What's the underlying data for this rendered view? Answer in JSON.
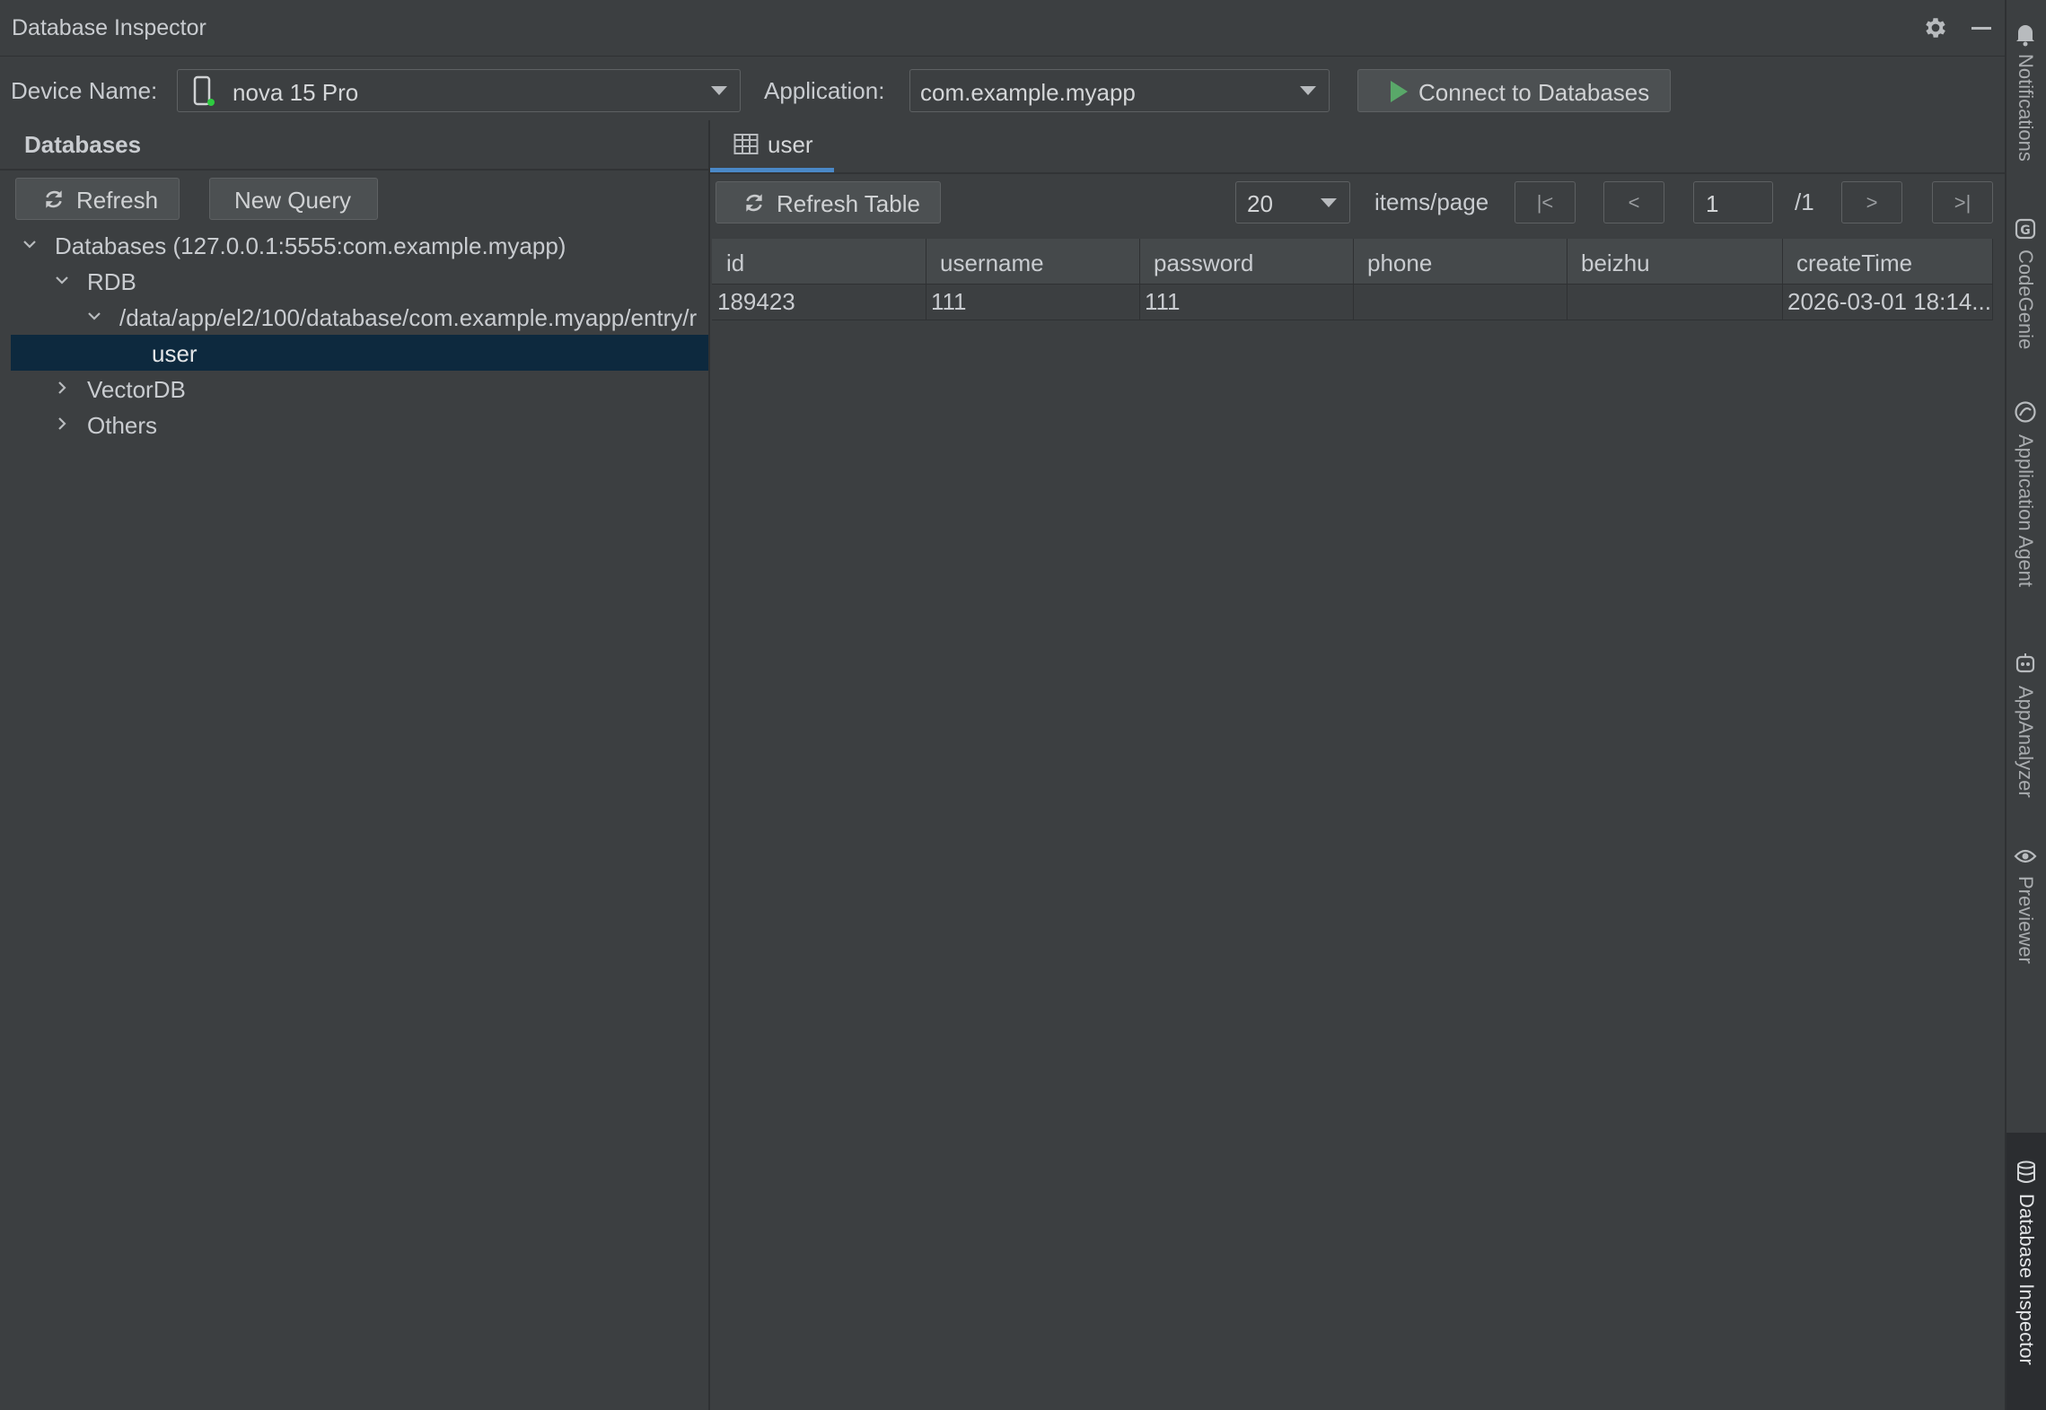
{
  "panel": {
    "title": "Database Inspector"
  },
  "toolbar": {
    "device_label": "Device Name:",
    "device_value": "nova 15 Pro",
    "application_label": "Application:",
    "application_value": "com.example.myapp",
    "connect_label": "Connect to Databases"
  },
  "databases": {
    "title": "Databases",
    "refresh_label": "Refresh",
    "new_query_label": "New Query",
    "tree": {
      "root": "Databases (127.0.0.1:5555:com.example.myapp)",
      "rdb": "RDB",
      "path": "/data/app/el2/100/database/com.example.myapp/entry/r",
      "table": "user",
      "vectordb": "VectorDB",
      "others": "Others"
    }
  },
  "table_view": {
    "tab_label": "user",
    "refresh_table_label": "Refresh Table",
    "page_size": "20",
    "items_per_page_label": "items/page",
    "first_label": "|<",
    "prev_label": "<",
    "page_current": "1",
    "page_total": "/1",
    "next_label": ">",
    "last_label": ">|",
    "columns": [
      "id",
      "username",
      "password",
      "phone",
      "beizhu",
      "createTime"
    ],
    "rows": [
      [
        "189423",
        "111",
        "111",
        "",
        "",
        "2026-03-01 18:14..."
      ]
    ]
  },
  "tool_windows": {
    "notifications": "Notifications",
    "codegenie": "CodeGenie",
    "application_agent": "Application Agent",
    "appanalyzer": "AppAnalyzer",
    "previewer": "Previewer",
    "database_inspector": "Database Inspector"
  },
  "colors": {
    "background": "#3c3f41",
    "selection": "#0d293e",
    "tab_accent": "#4a88c7",
    "run_green": "#59a869",
    "device_status_green": "#2ecc40"
  }
}
